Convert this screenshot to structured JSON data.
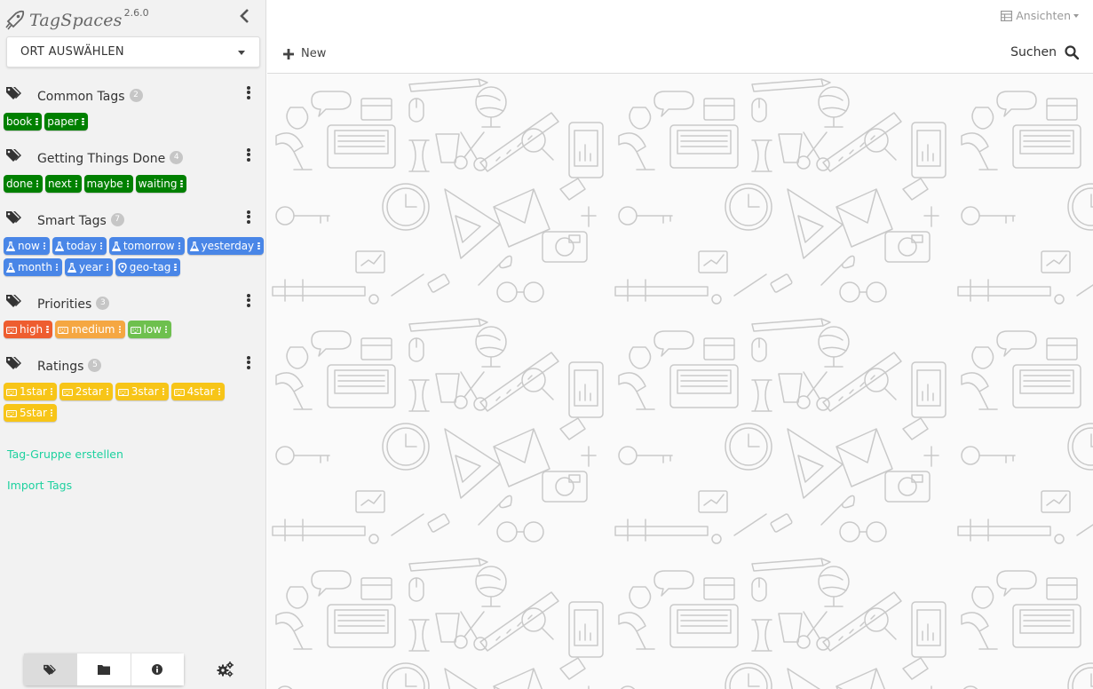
{
  "app": {
    "name": "TagSpaces",
    "version": "2.6.0"
  },
  "location_select": {
    "label": "ORT AUSWÄHLEN"
  },
  "tag_groups": [
    {
      "title": "Common Tags",
      "count": "2",
      "tags": [
        {
          "label": "book",
          "color": "#008000",
          "icon": ""
        },
        {
          "label": "paper",
          "color": "#008000",
          "icon": ""
        }
      ]
    },
    {
      "title": "Getting Things Done",
      "count": "4",
      "tags": [
        {
          "label": "done",
          "color": "#008000",
          "icon": ""
        },
        {
          "label": "next",
          "color": "#008000",
          "icon": ""
        },
        {
          "label": "maybe",
          "color": "#008000",
          "icon": ""
        },
        {
          "label": "waiting",
          "color": "#008000",
          "icon": ""
        }
      ]
    },
    {
      "title": "Smart Tags",
      "count": "7",
      "tags": [
        {
          "label": "now",
          "color": "#4986e7",
          "icon": "flask-icon"
        },
        {
          "label": "today",
          "color": "#4986e7",
          "icon": "flask-icon"
        },
        {
          "label": "tomorrow",
          "color": "#4986e7",
          "icon": "flask-icon"
        },
        {
          "label": "yesterday",
          "color": "#4986e7",
          "icon": "flask-icon"
        },
        {
          "label": "month",
          "color": "#4986e7",
          "icon": "flask-icon"
        },
        {
          "label": "year",
          "color": "#4986e7",
          "icon": "flask-icon"
        },
        {
          "label": "geo-tag",
          "color": "#4986e7",
          "icon": "map-marker-icon"
        }
      ]
    },
    {
      "title": "Priorities",
      "count": "3",
      "tags": [
        {
          "label": "high",
          "color": "#ee5d2f",
          "icon": "keyboard-icon"
        },
        {
          "label": "medium",
          "color": "#f5a742",
          "icon": "keyboard-icon"
        },
        {
          "label": "low",
          "color": "#6ec04e",
          "icon": "keyboard-icon"
        }
      ]
    },
    {
      "title": "Ratings",
      "count": "5",
      "tags": [
        {
          "label": "1star",
          "color": "#f7c518",
          "icon": "keyboard-icon"
        },
        {
          "label": "2star",
          "color": "#f7c518",
          "icon": "keyboard-icon"
        },
        {
          "label": "3star",
          "color": "#f7c518",
          "icon": "keyboard-icon"
        },
        {
          "label": "4star",
          "color": "#f7c518",
          "icon": "keyboard-icon"
        },
        {
          "label": "5star",
          "color": "#f7c518",
          "icon": "keyboard-icon"
        }
      ]
    }
  ],
  "links": {
    "create_group": "Tag-Gruppe erstellen",
    "import_tags": "Import Tags"
  },
  "bottom_tabs": [
    {
      "name": "tags",
      "icon": "tags-icon",
      "active": true
    },
    {
      "name": "folders",
      "icon": "folder-icon",
      "active": false
    },
    {
      "name": "info",
      "icon": "info-icon",
      "active": false
    }
  ],
  "settings": {
    "icon": "gears-icon"
  },
  "toolbar": {
    "views_label": "Ansichten",
    "new_label": "New",
    "search_label": "Suchen"
  },
  "colors": {
    "accent": "#1dd19f",
    "sidebar_bg": "#f2f2f2"
  }
}
